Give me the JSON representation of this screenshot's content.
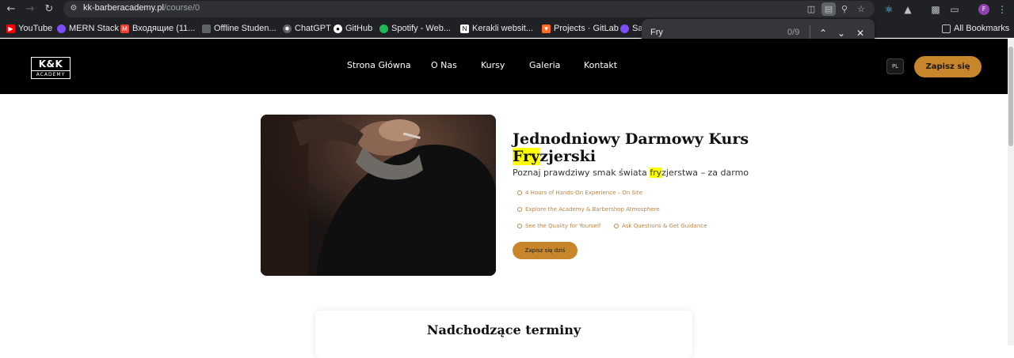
{
  "browser": {
    "url_host": "kk-barberacademy.pl",
    "url_path": "/course/0",
    "profile_initial": "F",
    "bookmarks": [
      {
        "label": "YouTube",
        "icon": "youtube-icon",
        "color": "#ff0000"
      },
      {
        "label": "MERN Stack",
        "icon": "mern-icon",
        "color": "#7c4dff"
      },
      {
        "label": "Входящие (11...",
        "icon": "gmail-icon",
        "color": "#ea4335"
      },
      {
        "label": "Offline Studen...",
        "icon": "offline-icon",
        "color": "#5f6368"
      },
      {
        "label": "ChatGPT",
        "icon": "chatgpt-icon",
        "color": "#5f6368"
      },
      {
        "label": "GitHub",
        "icon": "github-icon",
        "color": "#ffffff"
      },
      {
        "label": "Spotify - Web...",
        "icon": "spotify-icon",
        "color": "#1db954"
      },
      {
        "label": "Kerakli websit...",
        "icon": "notion-icon",
        "color": "#ffffff"
      },
      {
        "label": "Projects · GitLab",
        "icon": "gitlab-icon",
        "color": "#fc6d26"
      },
      {
        "label": "Sa",
        "icon": "sa-icon",
        "color": "#7c4dff"
      }
    ],
    "all_bookmarks_label": "All Bookmarks"
  },
  "find_bar": {
    "query": "Fry",
    "count": "0/9"
  },
  "site": {
    "logo_top": "K&K",
    "logo_bottom": "ACADEMY",
    "nav": [
      {
        "label": "Strona Główna"
      },
      {
        "label": "O Nas"
      },
      {
        "label": "Kursy"
      },
      {
        "label": "Galeria"
      },
      {
        "label": "Kontakt"
      }
    ],
    "lang": "PL",
    "signup": "Zapisz się",
    "accent_color": "#c8862a"
  },
  "hero": {
    "title_part1": "Jednodniowy Darmowy Kurs",
    "title_hl": "Fry",
    "title_rest": "zjerski",
    "sub_part1": "Poznaj prawdziwy smak świata ",
    "sub_hl": "fry",
    "sub_rest": "zjerstwa – za darmo",
    "features": [
      "4 Hours of Hands-On Experience – On Site",
      "Explore the Academy & Barbershop Atmosphere",
      "See the Quality for Yourself",
      "Ask Questions & Get Guidance"
    ],
    "cta": "Zapisz się dziś"
  },
  "dates": {
    "title": "Nadchodzące terminy"
  }
}
